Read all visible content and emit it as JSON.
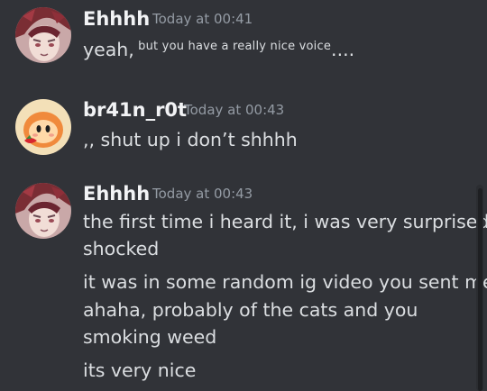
{
  "messages": [
    {
      "author": "Ehhhh",
      "timestamp": "Today at 00:41",
      "avatar_icon": "anime-character-avatar-icon",
      "lines": [
        {
          "main": "yeah,",
          "small": " but you have a really nice voice",
          "tail": "...."
        }
      ]
    },
    {
      "author": "br41n_r0t",
      "timestamp": "Today at 00:43",
      "avatar_icon": "waddle-dee-avatar-icon",
      "lines": [
        {
          "text": ",, shut up i don’t shhhh"
        }
      ]
    },
    {
      "author": "Ehhhh",
      "timestamp": "Today at 00:43",
      "avatar_icon": "anime-character-avatar-icon",
      "lines": [
        {
          "text": "the first time i heard it, i was very surprised."
        },
        {
          "text": "shocked"
        },
        {
          "text": "it was in some random ig video you sent me"
        },
        {
          "text": "ahaha, probably of the cats and you"
        },
        {
          "text": "smoking weed"
        },
        {
          "text": "its very nice"
        }
      ]
    }
  ],
  "colors": {
    "background": "#313338",
    "username": "#f2f3f5",
    "timestamp": "#949ba4",
    "message_text": "#dbdee1"
  }
}
